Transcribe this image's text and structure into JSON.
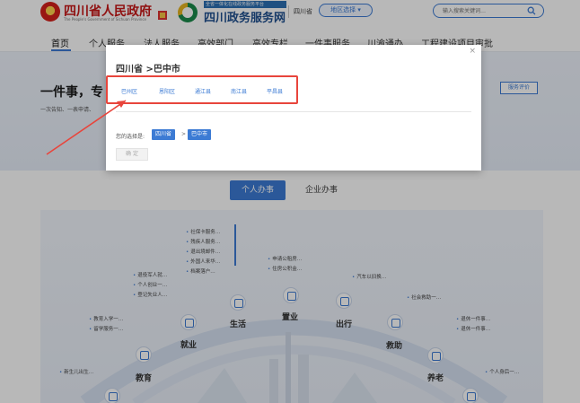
{
  "header": {
    "gov_title": "四川省人民政府",
    "gov_subtitle": "The People's Government of Sichuan Province",
    "service_top": "全省一体化在线政务服务平台",
    "service_title": "四川政务服务网",
    "region": "四川省",
    "region_select": "地区选择 ▾",
    "search_placeholder": "输入搜索关键词…"
  },
  "nav": {
    "items": [
      "首页",
      "个人服务",
      "法人服务",
      "高效部门",
      "高效专栏",
      "一件事服务",
      "川渝通办",
      "工程建设项目审批"
    ]
  },
  "banner": {
    "title": "一件事，专",
    "desc": "一次告知、一表申请、",
    "eval_button": "服务评价"
  },
  "tabs": {
    "person": "个人办事",
    "enterprise": "企业办事"
  },
  "categories": [
    {
      "label": "教育",
      "bullets": [
        "教育入学一…",
        "留学服务一…"
      ]
    },
    {
      "label": "就业",
      "bullets": [
        "退役军人就…",
        "个人创业一…",
        "登记失业人…"
      ]
    },
    {
      "label": "生活",
      "bullets": [
        "社保卡服务…",
        "残疾人服务…",
        "退出境邮件…",
        "外国人来华…",
        "档案落户…"
      ]
    },
    {
      "label": "置业",
      "bullets": [
        "申请公租房…",
        "住房公积金…"
      ]
    },
    {
      "label": "出行",
      "bullets": [
        "汽车以旧换…"
      ]
    },
    {
      "label": "救助",
      "bullets": [
        "社会救助一…"
      ]
    },
    {
      "label": "养老",
      "bullets": [
        "退休一件事…",
        "退休一件事…"
      ]
    },
    {
      "label": "",
      "bullets": [
        "新生儿出生…"
      ]
    },
    {
      "label": "",
      "bullets": [
        "个人身后一…"
      ]
    }
  ],
  "modal": {
    "close": "×",
    "title": "四川省 >巴中市",
    "districts": [
      "巴州区",
      "恩阳区",
      "通江县",
      "南江县",
      "平昌县"
    ],
    "chosen_label": "您的选择是:",
    "chosen": [
      "四川省",
      "巴中市"
    ],
    "chosen_separator": ">",
    "confirm": "确 定"
  },
  "colors": {
    "accent": "#3c7bd4",
    "annotation": "#e8453c",
    "gov_red": "#c81818"
  }
}
